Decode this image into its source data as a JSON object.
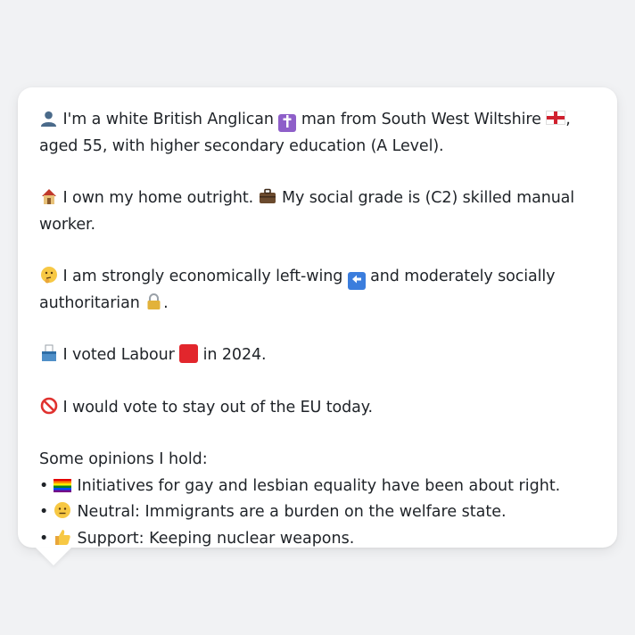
{
  "profile": {
    "line1_a": "I'm a white British Anglican",
    "line1_b": "man from South West Wiltshire",
    "line1_c": ", aged 55, with higher secondary education (A Level).",
    "line2_a": "I own my home outright.",
    "line2_b": "My social grade is (C2) skilled manual worker.",
    "line3_a": "I am strongly economically left-wing",
    "line3_b": "and moderately socially authoritarian",
    "line3_c": ".",
    "line4_a": "I voted Labour",
    "line4_b": "in 2024.",
    "line5": "I would vote to stay out of the EU today.",
    "opinions_heading": "Some opinions I hold:",
    "opinions": [
      {
        "text": "Initiatives for gay and lesbian equality have been about right."
      },
      {
        "text": "Neutral: Immigrants are a burden on the welfare state."
      },
      {
        "text": "Support: Keeping nuclear weapons."
      }
    ]
  },
  "icons": {
    "person": "bust-in-silhouette-icon",
    "cross": "latin-cross-icon",
    "flag": "england-flag-icon",
    "house": "house-icon",
    "briefcase": "briefcase-icon",
    "thinking": "thinking-face-icon",
    "left_arrow": "left-arrow-icon",
    "lock": "lock-icon",
    "ballot": "ballot-box-icon",
    "red_square": "red-square-icon",
    "no_entry": "prohibited-icon",
    "rainbow": "rainbow-flag-icon",
    "neutral": "neutral-face-icon",
    "thumbs_up": "thumbs-up-icon"
  },
  "colors": {
    "background": "#f1f2f4",
    "bubble": "#ffffff",
    "text": "#1f2328",
    "labour_red": "#e2262c",
    "cross_purple": "#8e5fc9",
    "arrow_blue": "#3b7ddd"
  }
}
